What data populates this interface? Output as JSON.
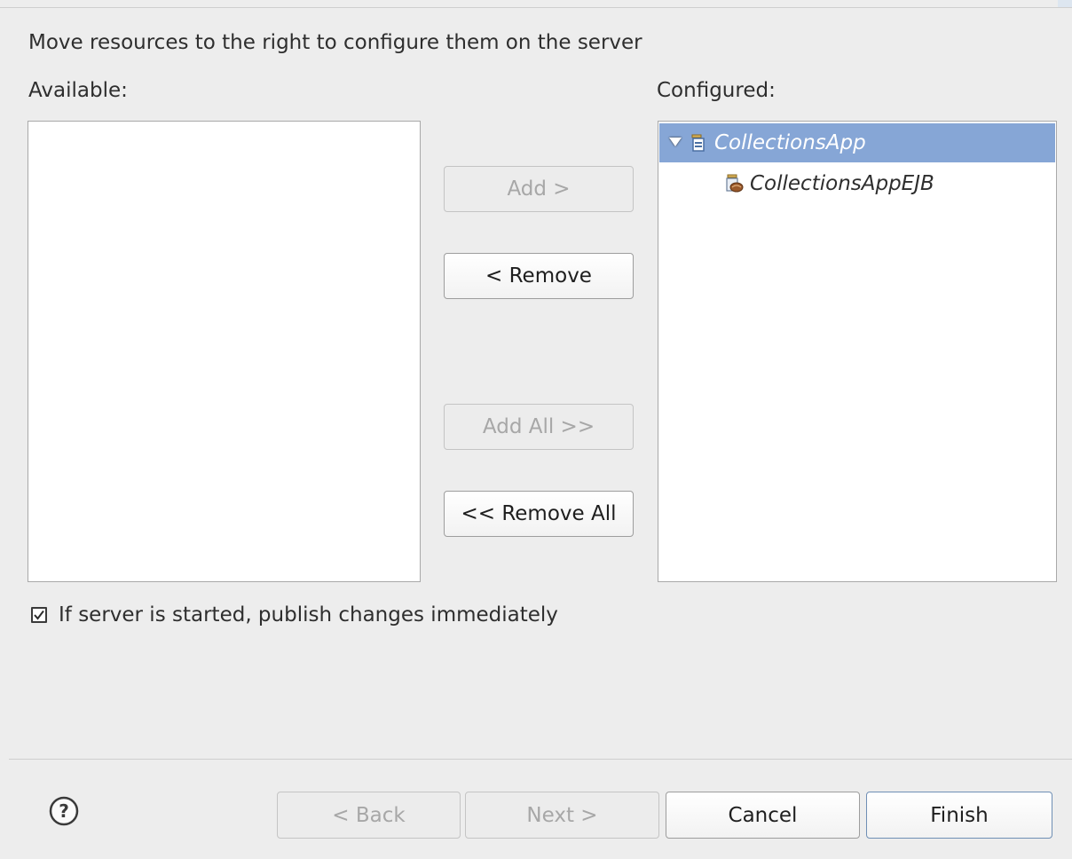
{
  "instruction": "Move resources to the right to configure them on the server",
  "available": {
    "label": "Available:",
    "items": []
  },
  "configured": {
    "label": "Configured:",
    "items": [
      {
        "label": "CollectionsApp",
        "icon": "ear-project-icon",
        "expanded": true,
        "selected": true
      },
      {
        "label": "CollectionsAppEJB",
        "icon": "ejb-module-icon",
        "expanded": false,
        "selected": false
      }
    ]
  },
  "buttons": {
    "add": "Add >",
    "remove": "< Remove",
    "add_all": "Add All >>",
    "remove_all": "<< Remove All"
  },
  "publish": {
    "label": "If server is started, publish changes immediately",
    "checked": true
  },
  "footer": {
    "help_icon": "help-icon",
    "back": "< Back",
    "next": "Next >",
    "cancel": "Cancel",
    "finish": "Finish"
  },
  "colors": {
    "background": "#ededed",
    "selection": "#86a6d6",
    "list_background": "#ffffff"
  }
}
